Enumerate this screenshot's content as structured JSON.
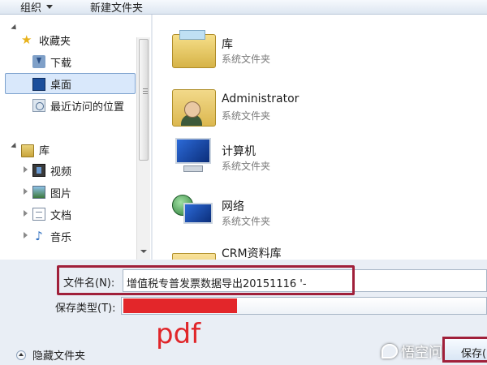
{
  "toolbar": {
    "organize_label": "组织",
    "new_folder_label": "新建文件夹"
  },
  "nav": {
    "favorites": {
      "label": "收藏夹",
      "items": [
        {
          "label": "下载",
          "icon": "download-icon"
        },
        {
          "label": "桌面",
          "icon": "desktop-icon",
          "selected": true
        },
        {
          "label": "最近访问的位置",
          "icon": "recent-places-icon"
        }
      ]
    },
    "libraries": {
      "label": "库",
      "items": [
        {
          "label": "视频",
          "icon": "video-icon"
        },
        {
          "label": "图片",
          "icon": "pictures-icon"
        },
        {
          "label": "文档",
          "icon": "documents-icon"
        },
        {
          "label": "音乐",
          "icon": "music-icon"
        }
      ]
    }
  },
  "content": {
    "items": [
      {
        "name": "库",
        "type": "系统文件夹",
        "icon": "library-icon"
      },
      {
        "name": "Administrator",
        "type": "系统文件夹",
        "icon": "user-folder-icon"
      },
      {
        "name": "计算机",
        "type": "系统文件夹",
        "icon": "computer-icon"
      },
      {
        "name": "网络",
        "type": "系统文件夹",
        "icon": "network-icon"
      },
      {
        "name": "CRM资料库",
        "type": "",
        "icon": "folder-icon"
      }
    ]
  },
  "form": {
    "filename_label": "文件名(N):",
    "filename_value": "增值税专普发票数据导出20151116 '-",
    "filetype_label": "保存类型(T):",
    "filetype_value": ""
  },
  "annotation": {
    "pdf_text": "pdf"
  },
  "footer": {
    "hide_folders_label": "隐藏文件夹",
    "save_label": "保存(",
    "watermark": "悟空问答"
  },
  "colors": {
    "highlight": "#a0203a",
    "redaction": "#e3262a",
    "selection": "#d9e8fb"
  }
}
